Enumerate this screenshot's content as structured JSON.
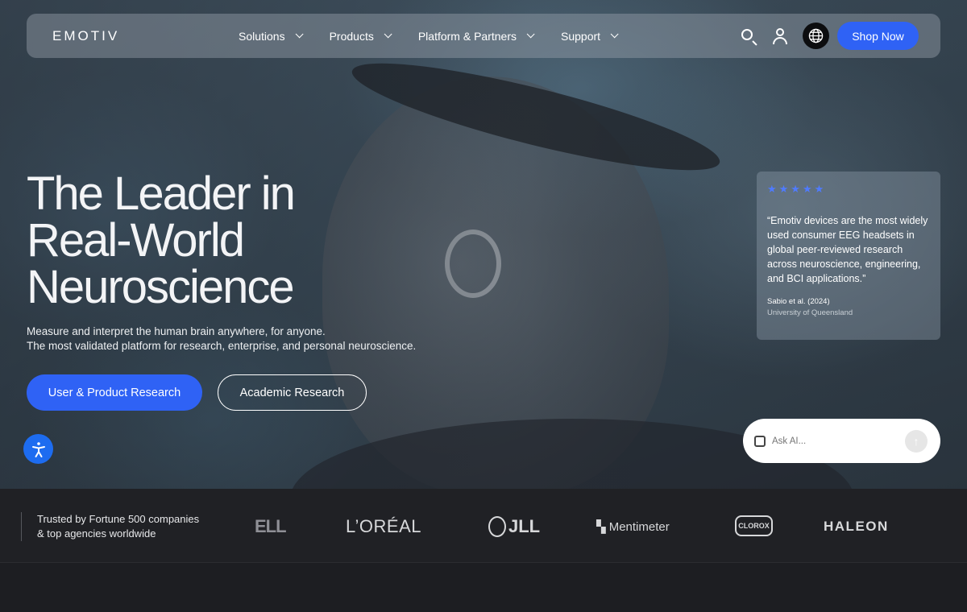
{
  "brand": {
    "logo_text": "EMOTIV"
  },
  "nav": {
    "items": [
      {
        "label": "Solutions"
      },
      {
        "label": "Products"
      },
      {
        "label": "Platform & Partners"
      },
      {
        "label": "Support"
      }
    ],
    "icons": [
      "search-icon",
      "user-icon",
      "globe-icon"
    ],
    "shop_label": "Shop Now"
  },
  "hero": {
    "headline_lines": [
      "The Leader in",
      "Real-World",
      "Neuroscience"
    ],
    "subcopy_lines": [
      "Measure and interpret the human brain anywhere, for anyone.",
      "The most validated platform for research, enterprise, and personal neuroscience."
    ],
    "primary_cta": "User & Product Research",
    "secondary_cta": "Academic Research"
  },
  "testimonial": {
    "stars": "★★★★★",
    "rating": 5,
    "quote": "“Emotiv devices are the most widely used consumer EEG headsets in global peer-reviewed research across neuroscience, engineering, and BCI applications.”",
    "author": "Sabio et al. (2024)",
    "organization": "University of Queensland"
  },
  "ask_ai": {
    "placeholder": "Ask AI..."
  },
  "trust": {
    "lines": [
      "Trusted by Fortune 500 companies",
      "& top agencies worldwide"
    ],
    "logos": [
      "ELL",
      "L’ORÉAL",
      "JLL",
      "Mentimeter",
      "CLOROX",
      "HALEON"
    ]
  },
  "colors": {
    "accent": "#2f62f5",
    "star": "#4f7bff",
    "accessibility_button": "#1d6cf0",
    "footer_bg": "#202125"
  }
}
